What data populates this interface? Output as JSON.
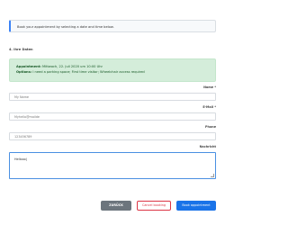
{
  "info_text": "Book your appointment by selecting a date and time below.",
  "section_title": "4. Ihre Daten",
  "confirmation": {
    "appointment_label": "Appointment:",
    "appointment_value": "Mittwoch, 22. Juli 2020 um 10:00 Uhr",
    "options_label": "Options:",
    "options_value": "I need a parking space; First time visitor; Wheelchair access required"
  },
  "form": {
    "name": {
      "label": "Name *",
      "placeholder": "My Name",
      "value": ""
    },
    "email": {
      "label": "E-Mail *",
      "placeholder": "",
      "value": "Myhello@mailde"
    },
    "phone": {
      "label": "Phone",
      "placeholder": "",
      "value": "123456789"
    },
    "message": {
      "label": "Nachricht",
      "value": "Hellooo|"
    }
  },
  "buttons": {
    "back": "ZURÜCK",
    "cancel": "Cancel booking",
    "book": "Book appointment"
  }
}
